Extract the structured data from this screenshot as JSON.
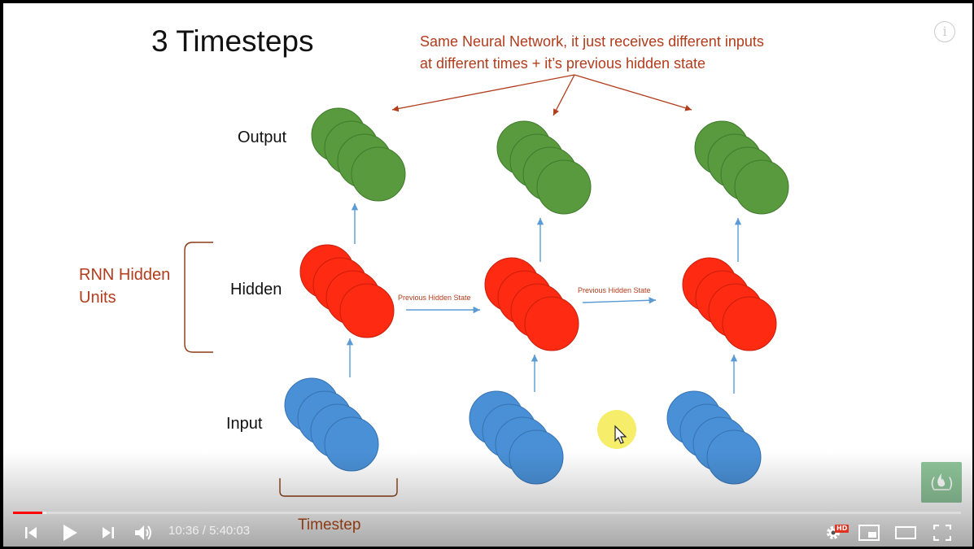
{
  "slide": {
    "title": "3 Timesteps",
    "annotation_line1": "Same Neural Network, it just receives different inputs",
    "annotation_line2": "at different times + it’s previous hidden state",
    "labels": {
      "output": "Output",
      "hidden": "Hidden",
      "input": "Input",
      "rnn_line1": "RNN Hidden",
      "rnn_line2": "Units",
      "prev_hidden_1": "Previous Hidden State",
      "prev_hidden_2": "Previous Hidden State",
      "timestep": "Timestep"
    },
    "colors": {
      "output_neuron": "#5a9a3e",
      "hidden_neuron": "#ff2a12",
      "input_neuron": "#4a90d6",
      "annotation_text": "#b23c1c",
      "arrow_blue": "#5b9bd5"
    },
    "info_icon": "i"
  },
  "player": {
    "current_time": "10:36",
    "separator": " / ",
    "duration": "5:40:03",
    "progress_fraction": 0.031,
    "buffered_fraction": 0.035,
    "hd_badge": "HD",
    "accent_color": "#ff0000",
    "icons": [
      "skip-previous-icon",
      "play-icon",
      "skip-next-icon",
      "volume-icon",
      "settings-icon",
      "miniplayer-icon",
      "theater-mode-icon",
      "fullscreen-icon"
    ]
  }
}
